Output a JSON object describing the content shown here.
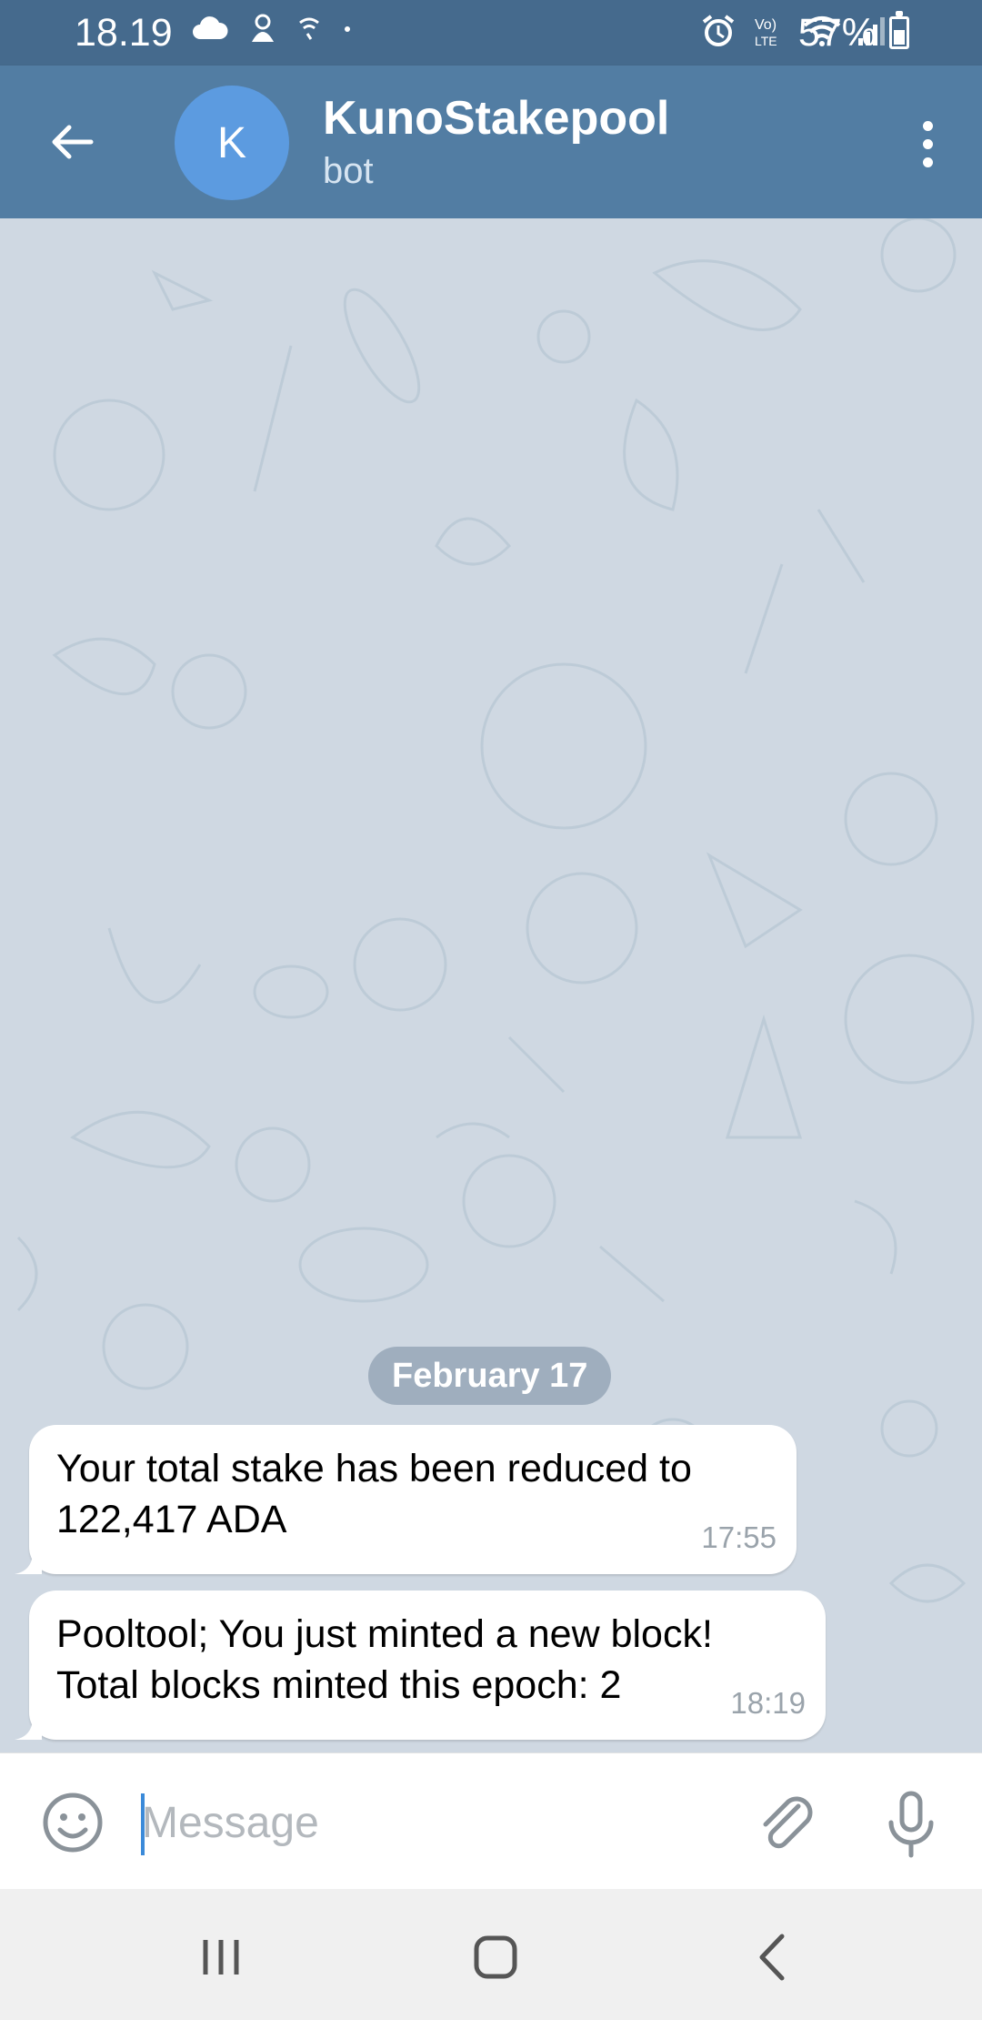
{
  "status_bar": {
    "time": "18.19",
    "battery": "57%",
    "battery_level": 0.57,
    "icons": [
      "cloud-icon",
      "notification-icon",
      "wifi-calling-icon",
      "dot-icon",
      "alarm-icon",
      "volte-icon",
      "wifi-icon",
      "signal-icon",
      "battery-icon"
    ]
  },
  "header": {
    "avatar_letter": "K",
    "title": "KunoStakepool",
    "subtitle": "bot",
    "back_icon": "arrow-left-icon",
    "menu_icon": "more-vertical-icon"
  },
  "chat": {
    "date_label": "February 17",
    "messages": [
      {
        "text": "Your total stake has been reduced to 122,417 ADA",
        "time": "17:55"
      },
      {
        "text": "Pooltool; You just minted a new block! Total blocks minted this epoch: 2",
        "time": "18:19"
      }
    ]
  },
  "composer": {
    "placeholder": "Message",
    "emoji_icon": "smiley-icon",
    "attach_icon": "paperclip-icon",
    "mic_icon": "microphone-icon"
  },
  "colors": {
    "header": "#527da3",
    "status_bar": "#456a8d",
    "chat_background": "#cfd8e2",
    "avatar": "#5c9be0",
    "cursor": "#3b8ad9"
  }
}
